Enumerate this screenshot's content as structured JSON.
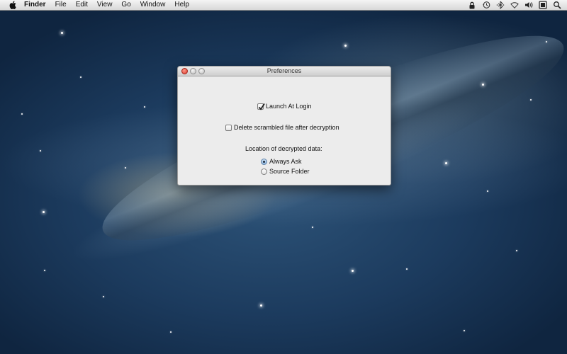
{
  "menubar": {
    "app_name": "Finder",
    "items": [
      "File",
      "Edit",
      "View",
      "Go",
      "Window",
      "Help"
    ]
  },
  "status_icons": [
    "lock-icon",
    "time-machine-icon",
    "bluetooth-icon",
    "wifi-icon",
    "volume-icon",
    "battery-icon",
    "spotlight-icon"
  ],
  "window": {
    "title": "Preferences",
    "launch_at_login": {
      "label": "Launch At Login",
      "checked": true
    },
    "delete_scrambled": {
      "label": "Delete scrambled file after decryption",
      "checked": false
    },
    "location_label": "Location of decrypted data:",
    "location_options": [
      {
        "label": "Always Ask",
        "selected": true
      },
      {
        "label": "Source Folder",
        "selected": false
      }
    ]
  },
  "colors": {
    "close_button": "#d9372b",
    "radio_selected": "#8fb6df",
    "window_bg": "#ececec"
  }
}
